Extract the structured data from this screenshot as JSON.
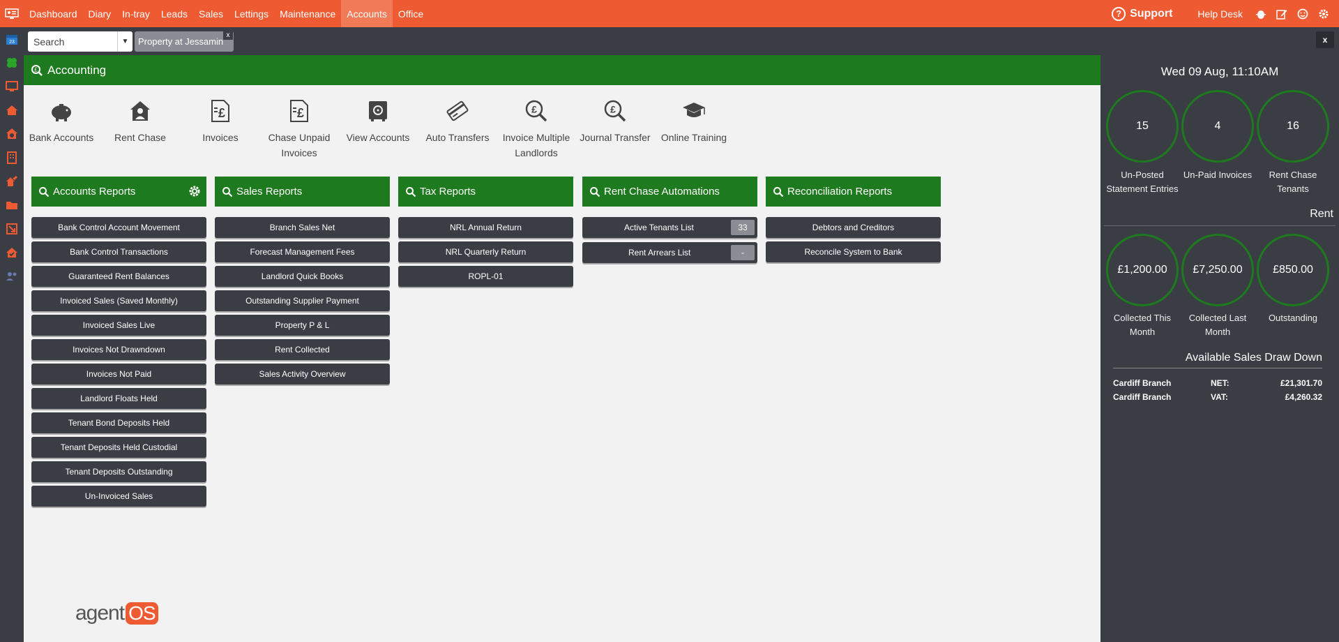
{
  "nav": {
    "items": [
      {
        "label": "Dashboard"
      },
      {
        "label": "Diary"
      },
      {
        "label": "In-tray"
      },
      {
        "label": "Leads"
      },
      {
        "label": "Sales"
      },
      {
        "label": "Lettings"
      },
      {
        "label": "Maintenance"
      },
      {
        "label": "Accounts",
        "active": true
      },
      {
        "label": "Office"
      }
    ],
    "support_label": "Support",
    "helpdesk_label": "Help Desk"
  },
  "sidebar": {
    "icons": [
      "calendar-icon",
      "clover-icon",
      "monitor-icon",
      "house-icon",
      "house-target-icon",
      "building-icon",
      "house-share-icon",
      "folder-icon",
      "arrow-box-icon",
      "house-check-icon",
      "users-icon"
    ]
  },
  "search": {
    "placeholder": "Search",
    "open_tab": "Property at Jessamin",
    "tab_close": "x",
    "close_all": "x"
  },
  "header": {
    "title": "Accounting"
  },
  "tiles": [
    {
      "label": "Bank Accounts",
      "icon": "piggy-bank-icon"
    },
    {
      "label": "Rent Chase",
      "icon": "house-person-icon"
    },
    {
      "label": "Invoices",
      "icon": "invoice-pound-icon"
    },
    {
      "label": "Chase Unpaid Invoices",
      "icon": "invoice-pound-icon"
    },
    {
      "label": "View Accounts",
      "icon": "safe-icon"
    },
    {
      "label": "Auto Transfers",
      "icon": "card-icon"
    },
    {
      "label": "Invoice Multiple Landlords",
      "icon": "pound-search-icon"
    },
    {
      "label": "Journal Transfer",
      "icon": "pound-search-icon"
    },
    {
      "label": "Online Training",
      "icon": "graduation-cap-icon"
    }
  ],
  "reports": [
    {
      "title": "Accounts Reports",
      "items": [
        "Bank Control Account Movement",
        "Bank Control Transactions",
        "Guaranteed Rent Balances",
        "Invoiced Sales (Saved Monthly)",
        "Invoiced Sales Live",
        "Invoices Not Drawndown",
        "Invoices Not Paid",
        "Landlord Floats Held",
        "Tenant Bond Deposits Held",
        "Tenant Deposits Held Custodial",
        "Tenant Deposits Outstanding",
        "Un-Invoiced Sales"
      ]
    },
    {
      "title": "Sales Reports",
      "items": [
        "Branch Sales Net",
        "Forecast Management Fees",
        "Landlord Quick Books",
        "Outstanding Supplier Payment",
        "Property P & L",
        "Rent Collected",
        "Sales Activity Overview"
      ]
    },
    {
      "title": "Tax Reports",
      "items": [
        "NRL Annual Return",
        "NRL Quarterly Return",
        "ROPL-01"
      ]
    },
    {
      "title": "Rent Chase Automations",
      "items": [
        "Active Tenants List",
        "Rent Arrears List"
      ],
      "badges": [
        "33",
        "-"
      ]
    },
    {
      "title": "Reconciliation Reports",
      "items": [
        "Debtors and Creditors",
        "Reconcile System to Bank"
      ]
    }
  ],
  "brand": {
    "left": "agent",
    "right": "OS"
  },
  "panel": {
    "datetime": "Wed 09 Aug, 11:10AM",
    "stats": [
      {
        "value": "15",
        "label_1": "Un-Posted",
        "label_2": "Statement Entries"
      },
      {
        "value": "4",
        "label_1": "Un-Paid Invoices",
        "label_2": ""
      },
      {
        "value": "16",
        "label_1": "Rent Chase",
        "label_2": "Tenants"
      }
    ],
    "rent_title": "Rent",
    "rent": [
      {
        "value": "£1,200.00",
        "label_1": "Collected This",
        "label_2": "Month"
      },
      {
        "value": "£7,250.00",
        "label_1": "Collected Last",
        "label_2": "Month"
      },
      {
        "value": "£850.00",
        "label_1": "Outstanding",
        "label_2": ""
      }
    ],
    "ssd_title": "Available Sales Draw Down",
    "ssd_rows": [
      {
        "branch": "Cardiff Branch",
        "type": "NET:",
        "amount": "£21,301.70"
      },
      {
        "branch": "Cardiff Branch",
        "type": "VAT:",
        "amount": "£4,260.32"
      }
    ]
  },
  "colors": {
    "accent": "#ee5a32",
    "green": "#1e7a1e",
    "dark": "#3a3d44"
  }
}
